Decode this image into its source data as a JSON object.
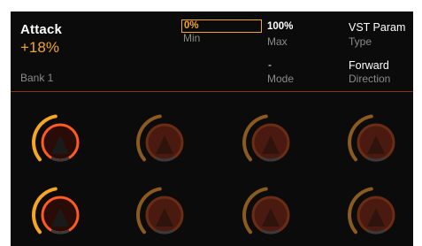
{
  "parameter": {
    "name": "Attack",
    "value": "+18%"
  },
  "bank": "Bank 1",
  "fields": {
    "min": {
      "value": "0%",
      "label": "Min"
    },
    "max": {
      "value": "100%",
      "label": "Max"
    },
    "mode": {
      "value": "-",
      "label": "Mode"
    },
    "type": {
      "value": "VST Param",
      "label": "Type"
    },
    "direction": {
      "value": "Forward",
      "label": "Direction"
    }
  },
  "colors": {
    "accent": "#f5a623",
    "active_ring": "#ff5a1f",
    "inactive_arc": "#8a5a1e",
    "inactive_ring": "#6a2c14",
    "knob_fill": "#4a1a10",
    "divider": "#8a3418"
  },
  "knobs": [
    {
      "name": "knob-1",
      "active": true,
      "level": 0.18
    },
    {
      "name": "knob-2",
      "active": false,
      "level": 0
    },
    {
      "name": "knob-3",
      "active": false,
      "level": 0
    },
    {
      "name": "knob-4",
      "active": false,
      "level": 0
    },
    {
      "name": "knob-5",
      "active": true,
      "level": 0.18
    },
    {
      "name": "knob-6",
      "active": false,
      "level": 0
    },
    {
      "name": "knob-7",
      "active": false,
      "level": 0
    },
    {
      "name": "knob-8",
      "active": false,
      "level": 0
    }
  ]
}
